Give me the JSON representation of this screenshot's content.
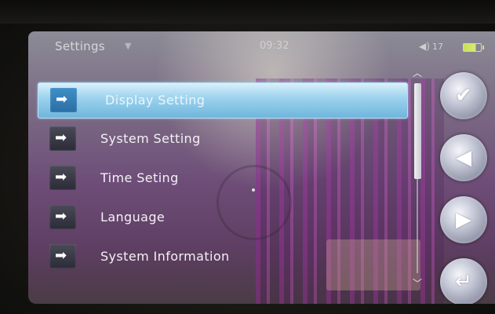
{
  "status_bar": {
    "title": "Settings",
    "time": "09:32",
    "volume": "17",
    "speaker_icon": "speaker-icon",
    "battery_icon": "battery-icon"
  },
  "menu": {
    "items": [
      {
        "label": "Display Setting",
        "icon": "arrow-right-icon",
        "selected": true
      },
      {
        "label": "System Setting",
        "icon": "arrow-right-icon",
        "selected": false
      },
      {
        "label": "Time Seting",
        "icon": "arrow-right-icon",
        "selected": false
      },
      {
        "label": "Language",
        "icon": "arrow-right-icon",
        "selected": false
      },
      {
        "label": "System Information",
        "icon": "arrow-right-icon",
        "selected": false
      }
    ]
  },
  "side_buttons": [
    {
      "name": "confirm",
      "icon": "check-icon"
    },
    {
      "name": "previous",
      "icon": "left-triangle-icon"
    },
    {
      "name": "next",
      "icon": "right-triangle-icon"
    },
    {
      "name": "enter",
      "icon": "enter-icon"
    }
  ],
  "colors": {
    "selected_highlight": "#9fd4ee",
    "menu_text": "#f4f1f6",
    "battery_fill": "#c7e05a"
  }
}
